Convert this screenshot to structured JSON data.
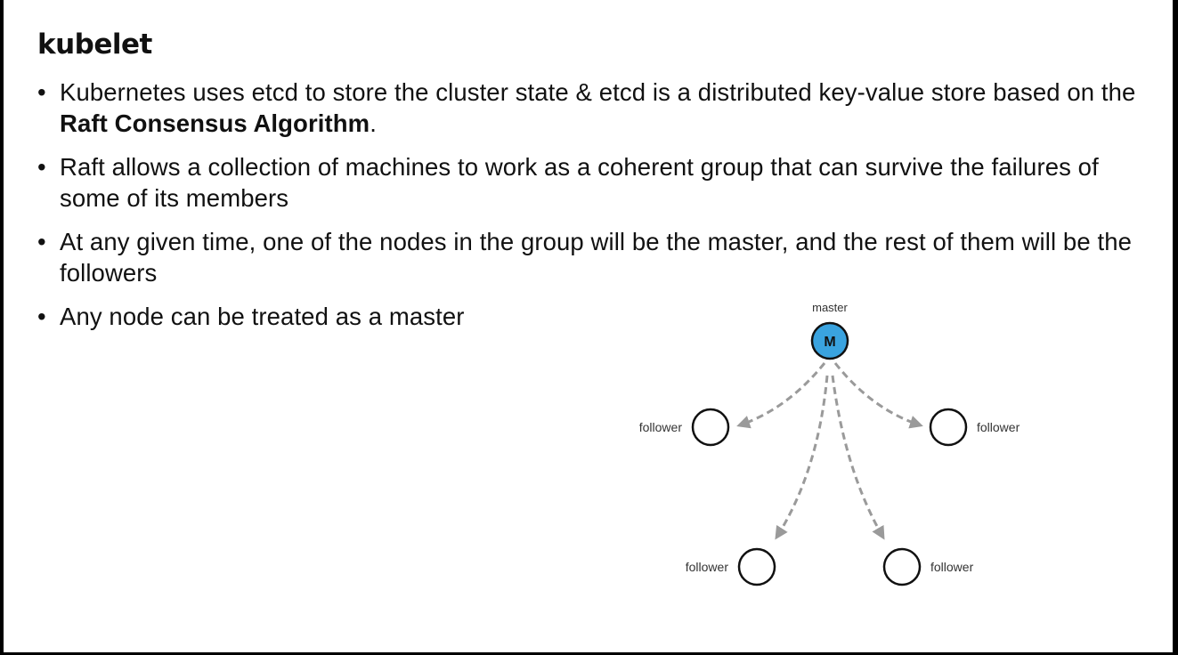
{
  "slide": {
    "title": "kubelet",
    "bullets": [
      {
        "before": "Kubernetes uses etcd to store the cluster state & etcd is a distributed key-value store based on the ",
        "bold": "Raft Consensus Algorithm",
        "after": "."
      },
      {
        "text": "Raft allows a collection of machines to work as a coherent group that can survive the failures of some of its members"
      },
      {
        "text": "At any given time, one of the nodes in the group will be the master, and the rest of them will be the followers"
      },
      {
        "text": "Any node can be treated as a master"
      }
    ]
  },
  "diagram": {
    "master_label": "master",
    "master_letter": "M",
    "follower_label": "follower",
    "colors": {
      "master_fill": "#3aa3df",
      "arrow": "#9a9a9a",
      "node_stroke": "#111111"
    }
  }
}
